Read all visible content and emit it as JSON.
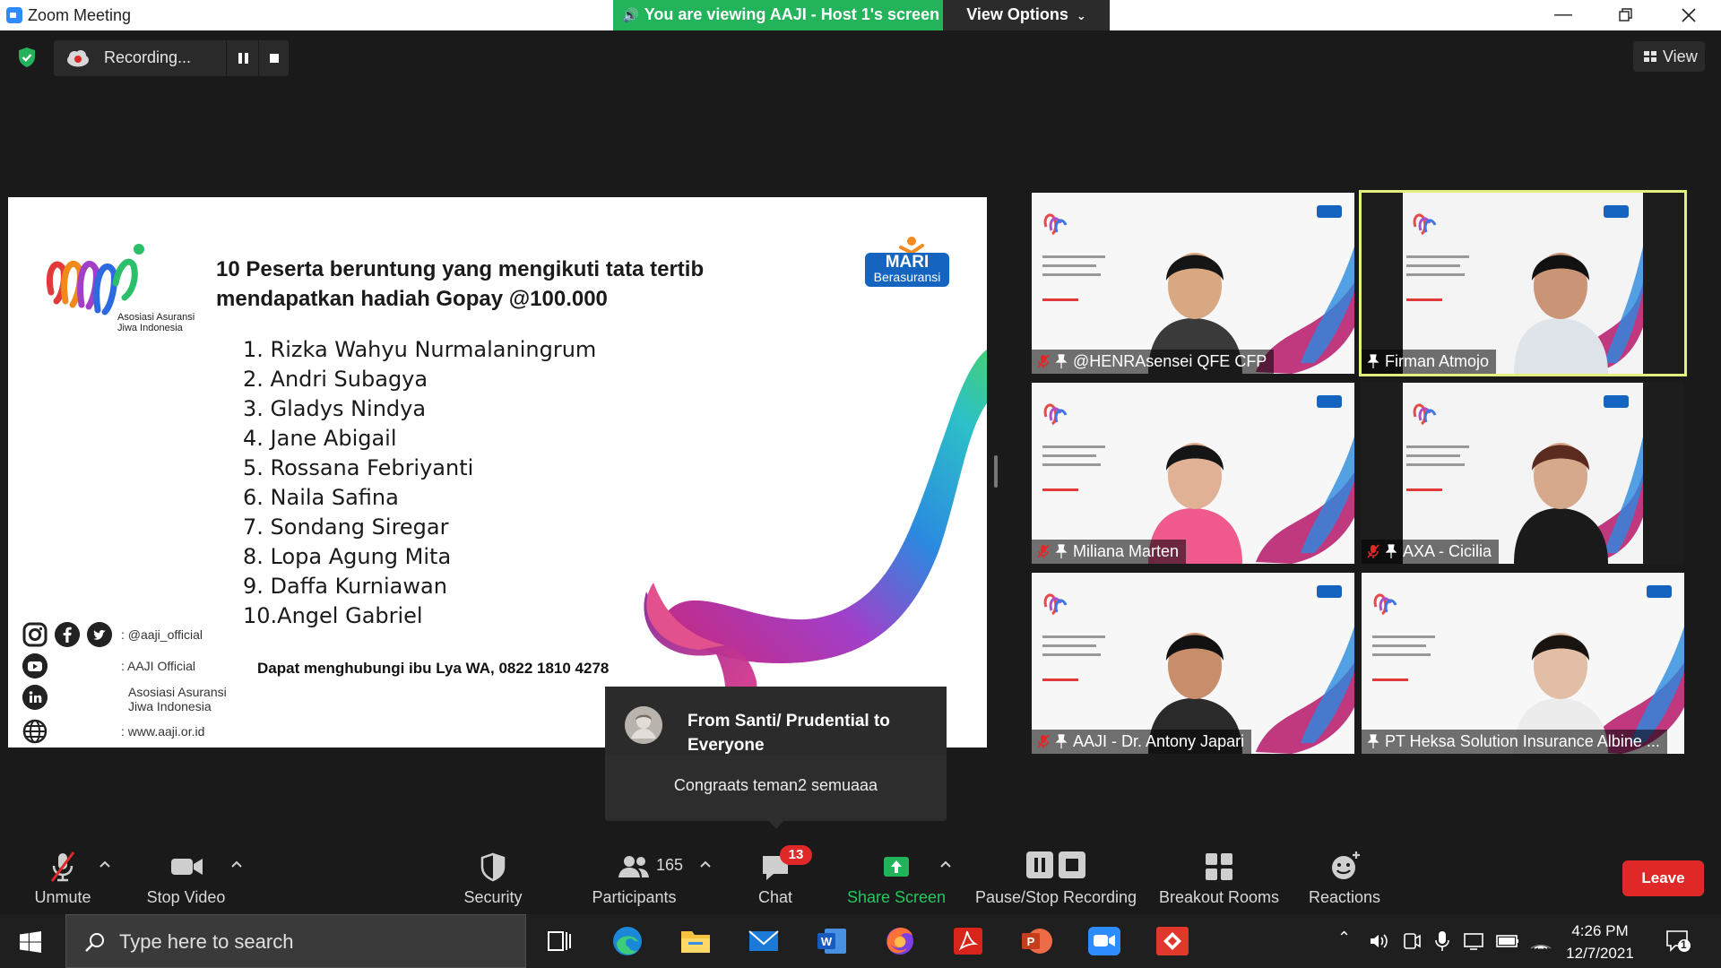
{
  "window": {
    "title": "Zoom Meeting",
    "viewing_banner": "You are viewing AAJI - Host 1's screen",
    "view_options": "View Options"
  },
  "recording": {
    "status": "Recording..."
  },
  "view_button": "View",
  "slide": {
    "org_caption": "Asosiasi Asuransi Jiwa Indonesia",
    "brand_logo_top": "MARI",
    "brand_logo_bottom": "Berasuransi",
    "headline_line1": "10 Peserta beruntung yang mengikuti tata tertib",
    "headline_line2": "mendapatkan hadiah Gopay @100.000",
    "winners": [
      "1.  Rizka Wahyu Nurmalaningrum",
      "2.  Andri Subagya",
      "3.  Gladys Nindya",
      "4.  Jane Abigail",
      "5.  Rossana Febriyanti",
      "6.  Naila Safina",
      "7.  Sondang Siregar",
      "8.  Lopa Agung Mita",
      "9.  Daffa Kurniawan",
      "10.Angel Gabriel"
    ],
    "contact": "Dapat menghubungi ibu Lya WA, 0822 1810 4278",
    "social": {
      "handle": ": @aaji_official",
      "youtube": ": AAJI Official",
      "linkedin_1": "Asosiasi Asuransi",
      "linkedin_2": "Jiwa Indonesia",
      "website": ": www.aaji.or.id"
    }
  },
  "participants_tiles": [
    {
      "name": "@HENRAsensei QFE CFP",
      "muted": true
    },
    {
      "name": "Firman Atmojo",
      "muted": false,
      "active_speaker": true
    },
    {
      "name": "Miliana Marten",
      "muted": true
    },
    {
      "name": "AXA - Cicilia",
      "muted": true
    },
    {
      "name": "AAJI - Dr. Antony Japari",
      "muted": true
    },
    {
      "name": "PT Heksa Solution Insurance Albine ...",
      "muted": false
    }
  ],
  "chat_popup": {
    "from": "From Santi/ Prudential to Everyone",
    "message": "Congraats teman2 semuaaa"
  },
  "toolbar": {
    "unmute": "Unmute",
    "stop_video": "Stop Video",
    "security": "Security",
    "participants": "Participants",
    "participants_count": "165",
    "chat": "Chat",
    "chat_badge": "13",
    "share_screen": "Share Screen",
    "pause_stop_recording": "Pause/Stop Recording",
    "breakout_rooms": "Breakout Rooms",
    "reactions": "Reactions",
    "leave": "Leave"
  },
  "taskbar": {
    "search_placeholder": "Type here to search",
    "time": "4:26 PM",
    "date": "12/7/2021",
    "notification_count": "1"
  },
  "colors": {
    "share_green": "#23b35b",
    "leave_red": "#e02828",
    "active_speaker": "#e4f07d",
    "zoom_blue": "#2d8cff"
  }
}
